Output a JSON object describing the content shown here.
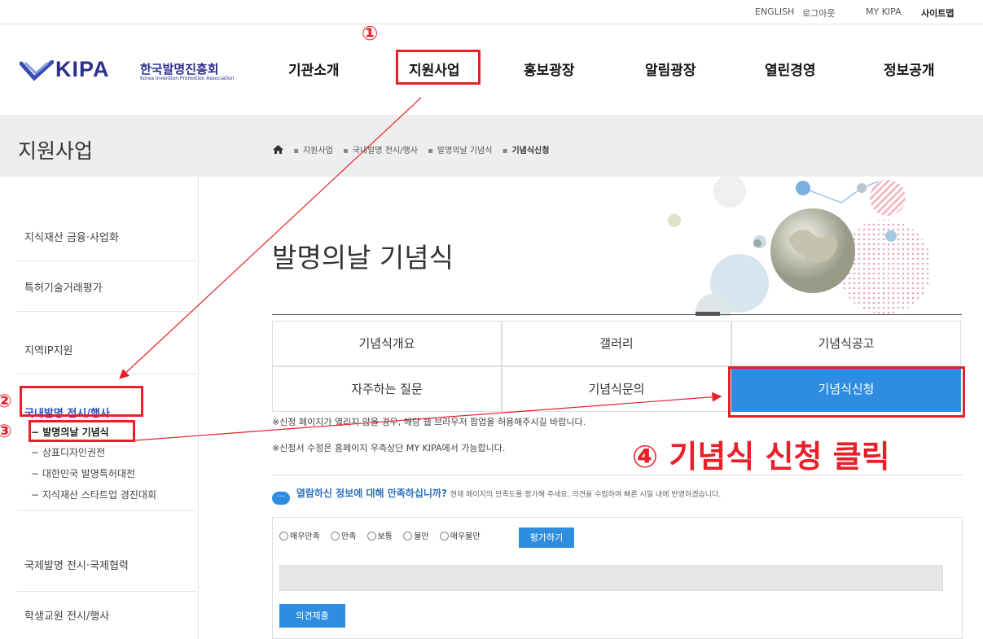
{
  "util_nav": [
    "ENGLISH",
    "로그아웃",
    "MY KIPA",
    "사이트맵"
  ],
  "logo": {
    "wordmark": "KIPA",
    "korean": "한국발명진흥회",
    "english": "Korea Invention Promotion Association"
  },
  "gnb": [
    "기관소개",
    "지원사업",
    "홍보광장",
    "알림광장",
    "열린경영",
    "정보공개"
  ],
  "section_title": "지원사업",
  "breadcrumb": [
    "지원사업",
    "국내발명 전시/행사",
    "발명의날 기념식",
    "기념식신청"
  ],
  "sidebar": {
    "items": [
      "지식재산 금융·사업화",
      "특허기술거래평가",
      "지역IP지원",
      "국내발명 전시/행사",
      "국제발명 전시·국제협력",
      "학생교원 전시/행사"
    ],
    "subitems": [
      "발명의날 기념식",
      "상표디자인권전",
      "대한민국 발명특허대전",
      "지식재산 스타트업 경진대회"
    ]
  },
  "page_title": "발명의날 기념식",
  "tabs": [
    "기념식개요",
    "갤러리",
    "기념식공고",
    "자주하는 질문",
    "기념식문의",
    "기념식신청"
  ],
  "notes": [
    "※신청 페이지가 열리지 않을 경우, 해당 웹 브라우저 팝업을 허용해주시길 바랍니다.",
    "※신청서 수정은 홈페이지 우측상단 MY KIPA에서 가능합니다."
  ],
  "feedback": {
    "icon": "···",
    "question": "열람하신 정보에 대해 만족하십니까?",
    "desc": "현재 페이지의 만족도를 평가해 주세요. 의견을 수렴하여 빠른 시일 내에 반영하겠습니다.",
    "options": [
      "매우만족",
      "만족",
      "보통",
      "불만",
      "매우불만"
    ],
    "eval_button": "평가하기",
    "submit_button": "의견제출"
  },
  "annotations": {
    "n1": "①",
    "n2": "②",
    "n3": "③",
    "callout": "④ 기념식 신청 클릭"
  },
  "colors": {
    "accent": "#2e8de0",
    "annotation": "#e8202a",
    "brand": "#2c2f8f"
  }
}
